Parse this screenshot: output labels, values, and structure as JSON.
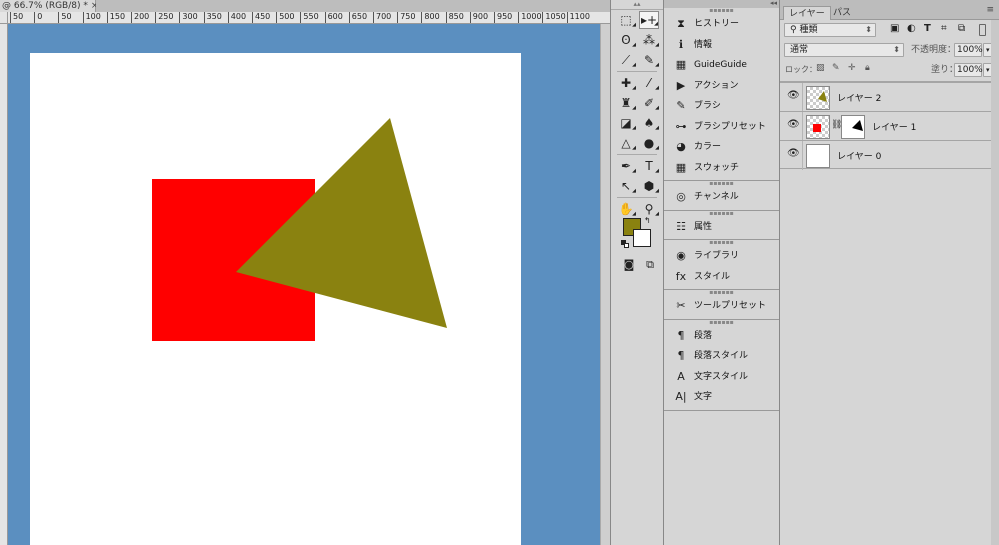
{
  "document": {
    "tab_title": "@ 66.7% (RGB/8) *",
    "close_glyph": "×",
    "ruler_ticks": [
      "50",
      "0",
      "50",
      "100",
      "150",
      "200",
      "250",
      "300",
      "350",
      "400",
      "450",
      "500",
      "550",
      "600",
      "650",
      "700",
      "750",
      "800",
      "850",
      "900",
      "950",
      "1000",
      "1050",
      "1100"
    ],
    "shapes": {
      "rectangle_color": "#ff0000",
      "triangle_color": "#8a8210",
      "canvas_color": "#ffffff",
      "pasteboard_color": "#5b8fc0"
    }
  },
  "tools": {
    "items": [
      [
        "marquee-tool",
        "⬚",
        "move-tool",
        "▸+"
      ],
      [
        "lasso-tool",
        "ʘ",
        "magic-wand-tool",
        "⁂"
      ],
      [
        "crop-tool",
        "⟋",
        "eyedropper-tool",
        "✎"
      ],
      [
        "healing-brush-tool",
        "✚",
        "brush-tool",
        "⁄"
      ],
      [
        "clone-stamp-tool",
        "♜",
        "history-brush-tool",
        "✐"
      ],
      [
        "eraser-tool",
        "◪",
        "paint-bucket-tool",
        "♠"
      ],
      [
        "blur-tool",
        "△",
        "dodge-tool",
        "●"
      ],
      [
        "pen-tool",
        "✒",
        "type-tool",
        "T"
      ],
      [
        "path-selection-tool",
        "↖",
        "shape-tool",
        "⬢"
      ],
      [
        "hand-tool",
        "✋",
        "zoom-tool",
        "⚲"
      ]
    ],
    "foreground_color": "#8a8210",
    "background_color": "#ffffff",
    "swap_glyph": "↰"
  },
  "dock": {
    "groups": [
      {
        "items": [
          {
            "icon": "history-icon",
            "glyph": "⧗",
            "label": "ヒストリー"
          },
          {
            "icon": "info-icon",
            "glyph": "ℹ",
            "label": "情報"
          },
          {
            "icon": "guideguide-icon",
            "glyph": "▦",
            "label": "GuideGuide"
          },
          {
            "icon": "actions-icon",
            "glyph": "▶",
            "label": "アクション"
          },
          {
            "icon": "brush-icon",
            "glyph": "✎",
            "label": "ブラシ"
          },
          {
            "icon": "brush-presets-icon",
            "glyph": "⊶",
            "label": "ブラシプリセット"
          },
          {
            "icon": "color-icon",
            "glyph": "◕",
            "label": "カラー"
          },
          {
            "icon": "swatches-icon",
            "glyph": "▦",
            "label": "スウォッチ"
          }
        ]
      },
      {
        "items": [
          {
            "icon": "channels-icon",
            "glyph": "◎",
            "label": "チャンネル"
          }
        ]
      },
      {
        "items": [
          {
            "icon": "properties-icon",
            "glyph": "☷",
            "label": "属性"
          }
        ]
      },
      {
        "items": [
          {
            "icon": "libraries-icon",
            "glyph": "◉",
            "label": "ライブラリ"
          },
          {
            "icon": "styles-icon",
            "glyph": "fx",
            "label": "スタイル"
          }
        ]
      },
      {
        "items": [
          {
            "icon": "tool-presets-icon",
            "glyph": "✂",
            "label": "ツールプリセット"
          }
        ]
      },
      {
        "items": [
          {
            "icon": "paragraph-icon",
            "glyph": "¶",
            "label": "段落"
          },
          {
            "icon": "paragraph-styles-icon",
            "glyph": "¶",
            "label": "段落スタイル"
          },
          {
            "icon": "character-styles-icon",
            "glyph": "A",
            "label": "文字スタイル"
          },
          {
            "icon": "character-icon",
            "glyph": "A|",
            "label": "文字"
          }
        ]
      }
    ]
  },
  "layers_panel": {
    "tabs": [
      "レイヤー",
      "パス"
    ],
    "filter_kind": "種類",
    "blend_mode": "通常",
    "opacity_label": "不透明度：",
    "opacity_value": "100%",
    "lock_label": "ロック：",
    "fill_label": "塗り：",
    "fill_value": "100%",
    "layers": [
      {
        "name": "レイヤー 2",
        "has_mask": false
      },
      {
        "name": "レイヤー 1",
        "has_mask": true
      },
      {
        "name": "レイヤー 0",
        "has_mask": false
      }
    ]
  }
}
